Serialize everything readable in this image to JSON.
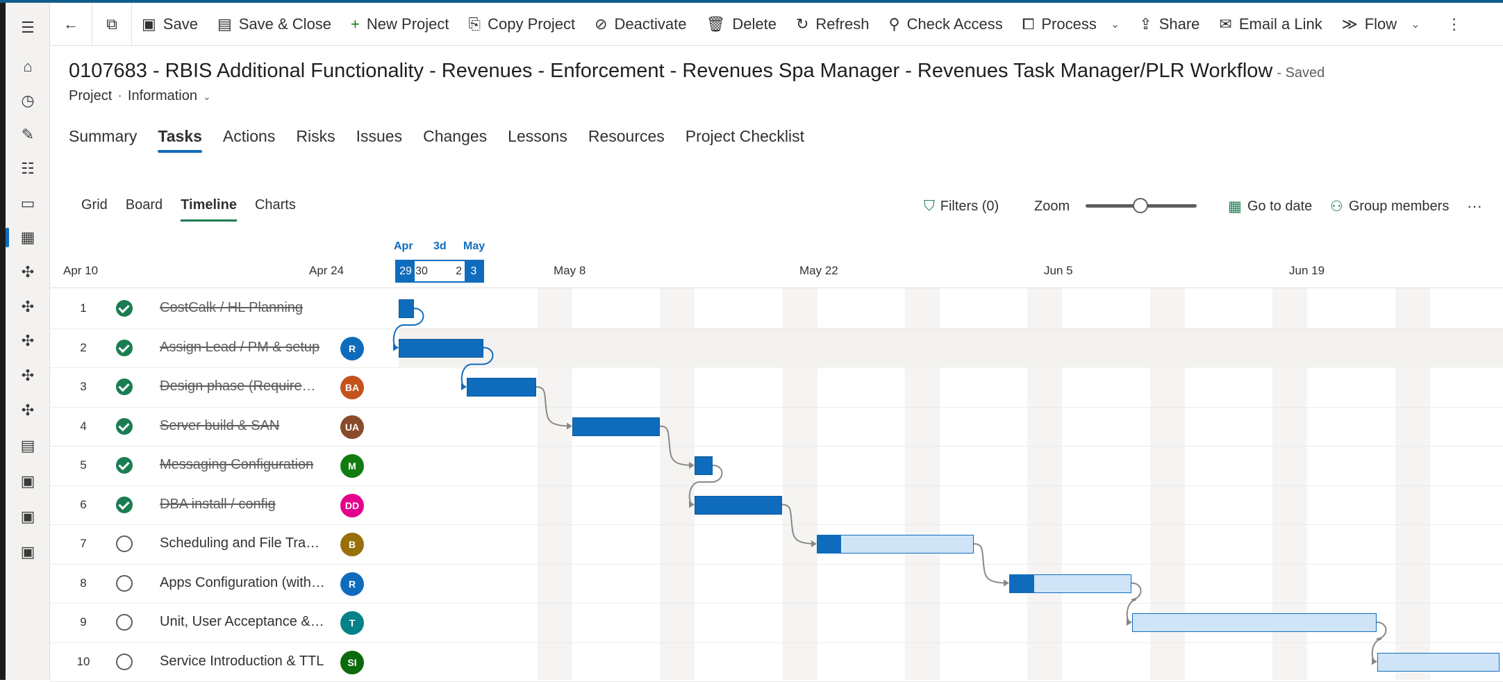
{
  "commandbar": {
    "save": "Save",
    "save_close": "Save & Close",
    "new_project": "New Project",
    "copy_project": "Copy Project",
    "deactivate": "Deactivate",
    "delete": "Delete",
    "refresh": "Refresh",
    "check_access": "Check Access",
    "process": "Process",
    "share": "Share",
    "email_link": "Email a Link",
    "flow": "Flow"
  },
  "header": {
    "title": "0107683 - RBIS Additional Functionality - Revenues - Enforcement - Revenues Spa Manager - Revenues Task Manager/PLR Workflow",
    "saved": "- Saved",
    "entity": "Project",
    "form": "Information"
  },
  "tabs": [
    "Summary",
    "Tasks",
    "Actions",
    "Risks",
    "Issues",
    "Changes",
    "Lessons",
    "Resources",
    "Project Checklist"
  ],
  "subtabs": [
    "Grid",
    "Board",
    "Timeline",
    "Charts"
  ],
  "tools": {
    "filters": "Filters (0)",
    "zoom": "Zoom",
    "go_to_date": "Go to date",
    "group_members": "Group members",
    "zoom_level": 0.5
  },
  "timeline": {
    "dates": [
      "Apr 10",
      "Apr 24",
      "May 8",
      "May 22",
      "Jun 5",
      "Jun 19"
    ],
    "mini_months": [
      "Apr",
      "3d",
      "May"
    ],
    "mini_days": [
      "29",
      "30",
      "2",
      "3"
    ]
  },
  "tasks": [
    {
      "num": "1",
      "name": "CostCalk / HL Planning",
      "done": true,
      "avatar": "",
      "color": ""
    },
    {
      "num": "2",
      "name": "Assign Lead / PM & setup",
      "done": true,
      "avatar": "R",
      "color": "#0f6cbd"
    },
    {
      "num": "3",
      "name": "Design phase (Requirements)",
      "done": true,
      "avatar": "BA",
      "color": "#c4521b"
    },
    {
      "num": "4",
      "name": "Server build & SAN",
      "done": true,
      "avatar": "UA",
      "color": "#8a4b2a"
    },
    {
      "num": "5",
      "name": "Messaging Configuration",
      "done": true,
      "avatar": "M",
      "color": "#107c10"
    },
    {
      "num": "6",
      "name": "DBA install / config",
      "done": true,
      "avatar": "DD",
      "color": "#e3008c"
    },
    {
      "num": "7",
      "name": "Scheduling and File Transfers",
      "done": false,
      "avatar": "B",
      "color": "#986f0b"
    },
    {
      "num": "8",
      "name": "Apps Configuration (with vendor)",
      "done": false,
      "avatar": "R",
      "color": "#0f6cbd"
    },
    {
      "num": "9",
      "name": "Unit, User Acceptance & Testing",
      "done": false,
      "avatar": "T",
      "color": "#038387"
    },
    {
      "num": "10",
      "name": "Service Introduction & TTL",
      "done": false,
      "avatar": "SI",
      "color": "#0b6a0b"
    }
  ],
  "task_progress": [
    1,
    1,
    1,
    1,
    1,
    1,
    0.15,
    0.2,
    0,
    0
  ]
}
